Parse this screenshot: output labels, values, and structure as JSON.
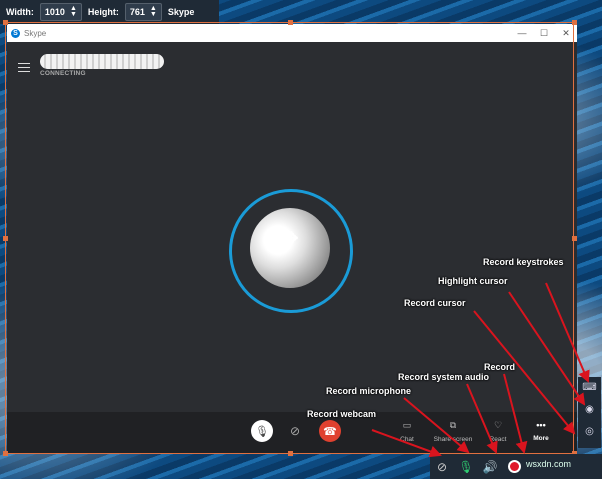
{
  "toolbar": {
    "width_label": "Width:",
    "width_value": "1010",
    "height_label": "Height:",
    "height_value": "761",
    "app_label": "Skype"
  },
  "window": {
    "title": "Skype",
    "minimize": "—",
    "maximize": "☐",
    "close": "✕"
  },
  "call": {
    "status": "CONNECTING"
  },
  "call_options": [
    {
      "label": "Chat",
      "icon": "chat-icon"
    },
    {
      "label": "Share screen",
      "icon": "share-screen-icon"
    },
    {
      "label": "React",
      "icon": "heart-icon"
    },
    {
      "label": "More",
      "icon": "more-icon"
    }
  ],
  "annotations": {
    "record_keystrokes": "Record keystrokes",
    "highlight_cursor": "Highlight cursor",
    "record_cursor": "Record cursor",
    "record": "Record",
    "record_system_audio": "Record system audio",
    "record_microphone": "Record microphone",
    "record_webcam": "Record webcam"
  },
  "watermark": "wsxdn.com",
  "colors": {
    "accent_ring": "#1a9bd7",
    "hangup": "#e0412f",
    "frame": "#e07040",
    "arrow": "#d9141e"
  }
}
